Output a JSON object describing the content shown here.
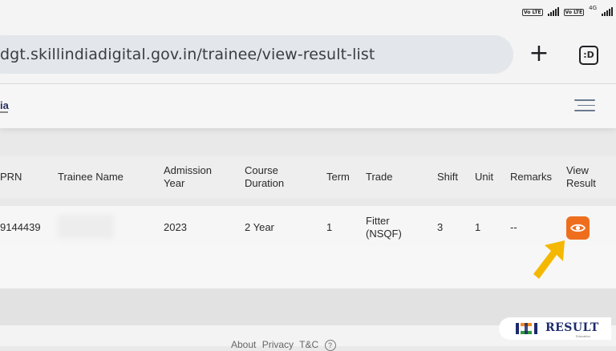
{
  "status_bar": {
    "volte1": "Vo LTE",
    "volte2": "Vo LTE",
    "network": "4G"
  },
  "browser": {
    "url": "dgt.skillindiadigital.gov.in/trainee/view-result-list",
    "new_tab_icon": "plus-icon",
    "tab_switcher_label": ":D"
  },
  "site_header": {
    "logo_fragment": "ia",
    "menu_icon": "hamburger-icon"
  },
  "table": {
    "headers": {
      "prn": "PRN",
      "trainee_name": "Trainee Name",
      "admission_year_1": "Admission",
      "admission_year_2": "Year",
      "course_duration_1": "Course",
      "course_duration_2": "Duration",
      "term": "Term",
      "trade": "Trade",
      "shift": "Shift",
      "unit": "Unit",
      "remarks": "Remarks",
      "view_result_1": "View",
      "view_result_2": "Result"
    },
    "rows": [
      {
        "prn": "9144439",
        "admission_year": "2023",
        "course_duration": "2 Year",
        "term": "1",
        "trade_1": "Fitter",
        "trade_2": "(NSQF)",
        "shift": "3",
        "unit": "1",
        "remarks": "--",
        "view_icon": "eye-icon"
      }
    ]
  },
  "footer": {
    "about": "About",
    "privacy": "Privacy",
    "tc": "T&C",
    "help": "?"
  },
  "watermark": {
    "text": "RESULT",
    "sub": "Education"
  },
  "colors": {
    "view_button": "#ef6e1e",
    "arrow": "#f5b800",
    "url_pill": "#e3e6ea"
  }
}
